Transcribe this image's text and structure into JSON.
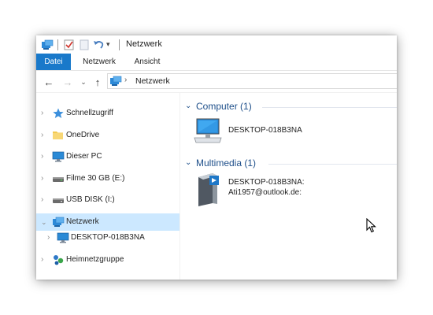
{
  "window": {
    "title": "Netzwerk"
  },
  "ribbon": {
    "tabs": [
      {
        "label": "Datei"
      },
      {
        "label": "Netzwerk"
      },
      {
        "label": "Ansicht"
      }
    ]
  },
  "address": {
    "crumb": "Netzwerk"
  },
  "sidebar": {
    "items": [
      {
        "label": "Schnellzugriff",
        "icon": "star-icon"
      },
      {
        "label": "OneDrive",
        "icon": "folder-icon"
      },
      {
        "label": "Dieser PC",
        "icon": "monitor-icon"
      },
      {
        "label": "Filme 30 GB (E:)",
        "icon": "drive-icon"
      },
      {
        "label": "USB DISK (I:)",
        "icon": "usb-drive-icon"
      },
      {
        "label": "Netzwerk",
        "icon": "network-icon",
        "selected": true
      },
      {
        "label": "DESKTOP-018B3NA",
        "icon": "computer-icon"
      },
      {
        "label": "Heimnetzgruppe",
        "icon": "homegroup-icon"
      }
    ]
  },
  "content": {
    "groups": [
      {
        "title": "Computer (1)",
        "items": [
          {
            "label": "DESKTOP-018B3NA"
          }
        ]
      },
      {
        "title": "Multimedia (1)",
        "items": [
          {
            "label_line1": "DESKTOP-018B3NA:",
            "label_line2": "Ati1957@outlook.de:"
          }
        ]
      }
    ]
  },
  "colors": {
    "accent": "#1979ca",
    "selection": "#cce8ff",
    "group_title": "#1e4f8a"
  }
}
